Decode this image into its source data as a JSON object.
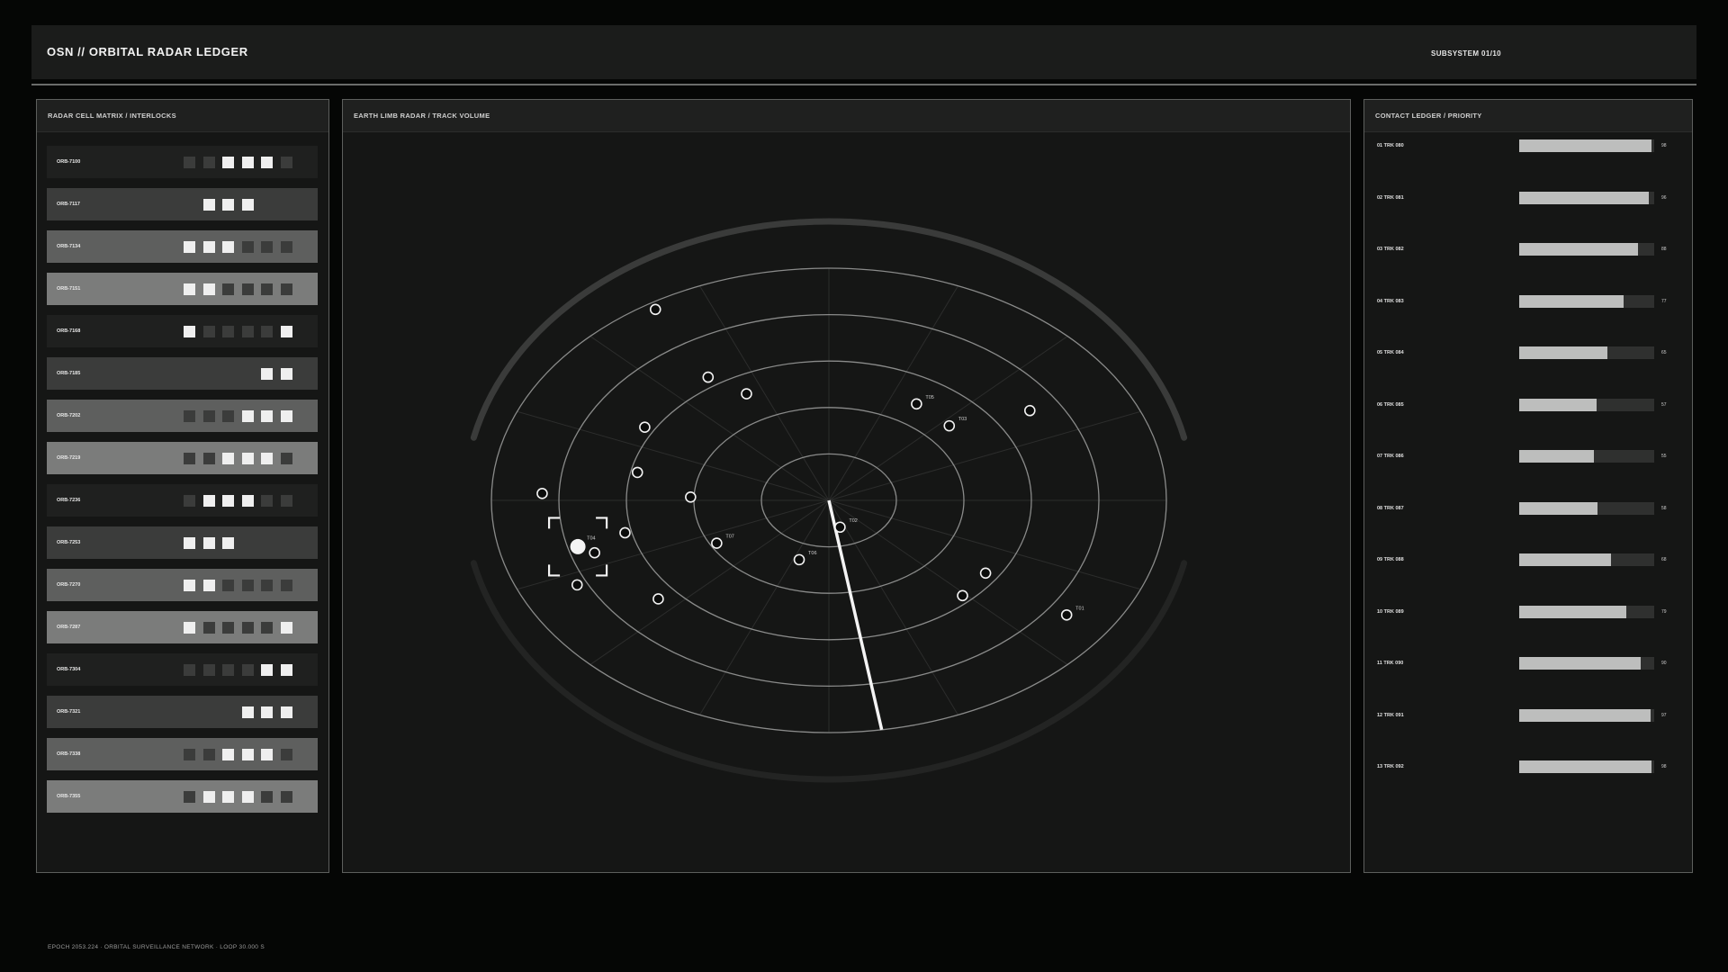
{
  "header": {
    "title": "OSN // ORBITAL RADAR LEDGER",
    "subsystem": "SUBSYSTEM 01/10"
  },
  "left_panel": {
    "title": "RADAR CELL MATRIX / INTERLOCKS",
    "cells": [
      {
        "id": "ORB-7100",
        "bg": "#1f201f",
        "states": [
          0,
          0,
          1,
          1,
          1,
          0
        ]
      },
      {
        "id": "ORB-7117",
        "bg": "#3b3c3b",
        "states": [
          0,
          1,
          1,
          1,
          0,
          0
        ]
      },
      {
        "id": "ORB-7134",
        "bg": "#5e5f5e",
        "states": [
          1,
          1,
          1,
          0,
          0,
          0
        ]
      },
      {
        "id": "ORB-7151",
        "bg": "#7b7c7b",
        "states": [
          1,
          1,
          0,
          0,
          0,
          0
        ]
      },
      {
        "id": "ORB-7168",
        "bg": "#1f201f",
        "states": [
          1,
          0,
          0,
          0,
          0,
          1
        ]
      },
      {
        "id": "ORB-7185",
        "bg": "#3b3c3b",
        "states": [
          0,
          0,
          0,
          0,
          1,
          1
        ]
      },
      {
        "id": "ORB-7202",
        "bg": "#5e5f5e",
        "states": [
          0,
          0,
          0,
          1,
          1,
          1
        ]
      },
      {
        "id": "ORB-7219",
        "bg": "#7b7c7b",
        "states": [
          0,
          0,
          1,
          1,
          1,
          0
        ]
      },
      {
        "id": "ORB-7236",
        "bg": "#1f201f",
        "states": [
          0,
          1,
          1,
          1,
          0,
          0
        ]
      },
      {
        "id": "ORB-7253",
        "bg": "#3b3c3b",
        "states": [
          1,
          1,
          1,
          0,
          0,
          0
        ]
      },
      {
        "id": "ORB-7270",
        "bg": "#5e5f5e",
        "states": [
          1,
          1,
          0,
          0,
          0,
          0
        ]
      },
      {
        "id": "ORB-7287",
        "bg": "#7b7c7b",
        "states": [
          1,
          0,
          0,
          0,
          0,
          1
        ]
      },
      {
        "id": "ORB-7304",
        "bg": "#1f201f",
        "states": [
          0,
          0,
          0,
          0,
          1,
          1
        ]
      },
      {
        "id": "ORB-7321",
        "bg": "#3b3c3b",
        "states": [
          0,
          0,
          0,
          1,
          1,
          1
        ]
      },
      {
        "id": "ORB-7338",
        "bg": "#5e5f5e",
        "states": [
          0,
          0,
          1,
          1,
          1,
          0
        ]
      },
      {
        "id": "ORB-7355",
        "bg": "#7b7c7b",
        "states": [
          0,
          1,
          1,
          1,
          0,
          0
        ]
      }
    ]
  },
  "center_panel": {
    "title": "EARTH LIMB RADAR / TRACK VOLUME",
    "radar": {
      "ring_count": 5,
      "spoke_count": 16,
      "sweep_angle_deg": 81,
      "contacts": [
        {
          "r": 0.12,
          "a": 74,
          "label": "T02"
        },
        {
          "r": 0.48,
          "a": -42,
          "label": "T03"
        },
        {
          "r": 0.49,
          "a": -58,
          "label": "T05"
        },
        {
          "r": 0.71,
          "a": -33,
          "label": ""
        },
        {
          "r": 0.52,
          "a": -118,
          "label": ""
        },
        {
          "r": 0.64,
          "a": -124,
          "label": ""
        },
        {
          "r": 0.97,
          "a": -122,
          "label": ""
        },
        {
          "r": 0.63,
          "a": -150,
          "label": ""
        },
        {
          "r": 0.58,
          "a": -168,
          "label": ""
        },
        {
          "r": 0.41,
          "a": -178,
          "label": ""
        },
        {
          "r": 0.85,
          "a": -178,
          "label": ""
        },
        {
          "r": 0.73,
          "a": 162,
          "label": ""
        },
        {
          "r": 0.38,
          "a": -209,
          "label": "T07"
        },
        {
          "r": 0.62,
          "a": 167,
          "label": ""
        },
        {
          "r": 0.66,
          "a": 140,
          "label": ""
        },
        {
          "r": 0.83,
          "a": 154,
          "label": ""
        },
        {
          "r": 0.27,
          "a": 109,
          "label": "T06"
        },
        {
          "r": 0.56,
          "a": 34,
          "label": ""
        },
        {
          "r": 0.57,
          "a": 46,
          "label": ""
        },
        {
          "r": 0.86,
          "a": 35,
          "label": "T01"
        }
      ],
      "selected": {
        "r": 0.77,
        "a": 165,
        "label": "T04"
      }
    }
  },
  "right_panel": {
    "title": "CONTACT LEDGER / PRIORITY",
    "contacts": [
      {
        "label": "01  TRK 080",
        "value": 98
      },
      {
        "label": "02  TRK 081",
        "value": 96
      },
      {
        "label": "03  TRK 082",
        "value": 88
      },
      {
        "label": "04  TRK 083",
        "value": 77
      },
      {
        "label": "05  TRK 084",
        "value": 65
      },
      {
        "label": "06  TRK 085",
        "value": 57
      },
      {
        "label": "07  TRK 086",
        "value": 55
      },
      {
        "label": "08  TRK 087",
        "value": 58
      },
      {
        "label": "09  TRK 088",
        "value": 68
      },
      {
        "label": "10  TRK 089",
        "value": 79
      },
      {
        "label": "11  TRK 090",
        "value": 90
      },
      {
        "label": "12  TRK 091",
        "value": 97
      },
      {
        "label": "13  TRK 092",
        "value": 98
      }
    ]
  },
  "footer": {
    "text": "EPOCH 2053.224 · ORBITAL SURVEILLANCE NETWORK · LOOP 30.000 S"
  }
}
